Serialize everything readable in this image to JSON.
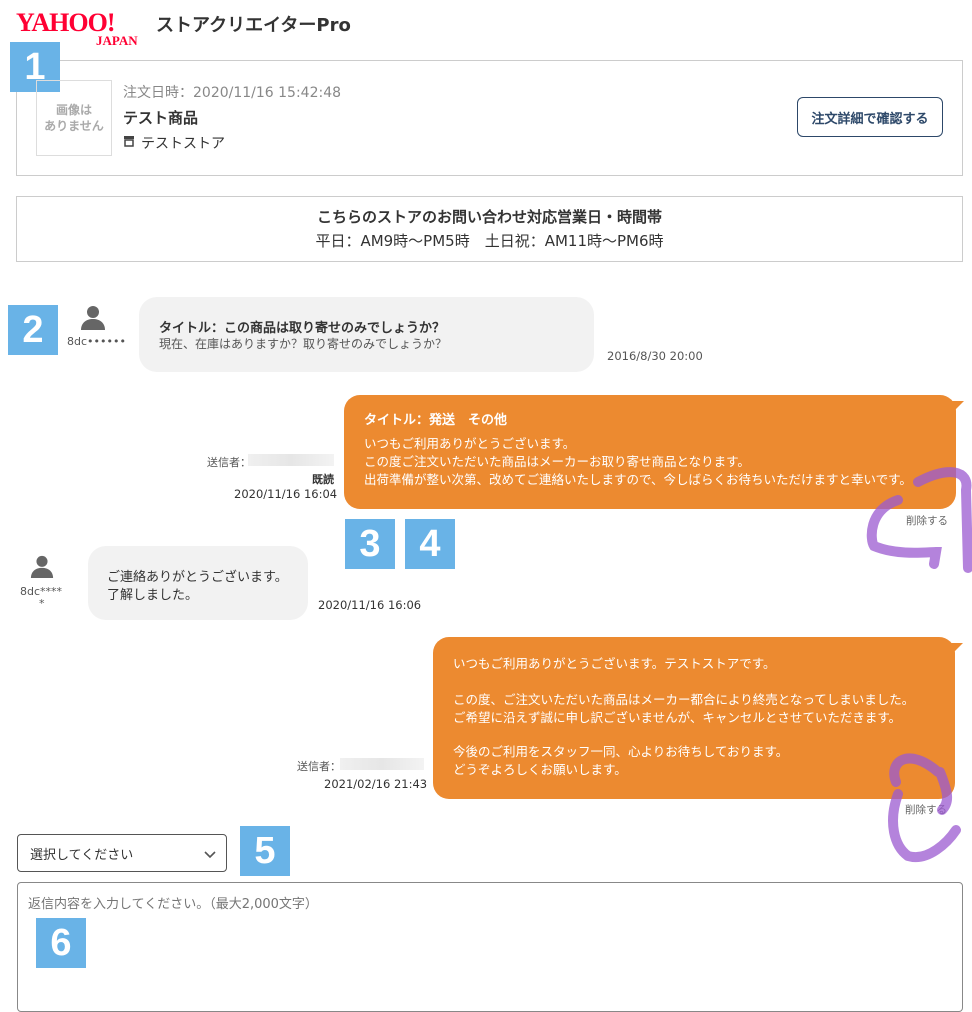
{
  "header": {
    "logo_main": "YAHOO!",
    "logo_sub": "JAPAN",
    "app_title": "ストアクリエイターPro"
  },
  "badges": [
    "1",
    "2",
    "3",
    "4",
    "5",
    "6"
  ],
  "order": {
    "date_label": "注文日時：2020/11/16 15:42:48",
    "product_name": "テスト商品",
    "store_name": "テストストア",
    "no_image_line1": "画像は",
    "no_image_line2": "ありません",
    "detail_button": "注文詳細で確認する"
  },
  "hours": {
    "title": "こちらのストアのお問い合わせ対応営業日・時間帯",
    "text": "平日：AM9時〜PM5時　土日祝：AM11時〜PM6時"
  },
  "messages": [
    {
      "sender": "8dc••••••",
      "title": "タイトル：この商品は取り寄せのみでしょうか？",
      "body": "現在、在庫はありますか？取り寄せのみでしょうか？",
      "time": "2016/8/30 20:00"
    },
    {
      "sender_label": "送信者：",
      "read": "既読",
      "time": "2020/11/16 16:04",
      "title": "タイトル：発送　その他",
      "lines": [
        "いつもご利用ありがとうございます。",
        "この度ご注文いただいた商品はメーカーお取り寄せ商品となります。",
        "出荷準備が整い次第、改めてご連絡いたしますので、今しばらくお待ちいただけますと幸いです。"
      ],
      "delete": "削除する"
    },
    {
      "sender": "8dc****",
      "sender2": "*",
      "lines": [
        "ご連絡ありがとうございます。",
        "了解しました。"
      ],
      "time": "2020/11/16 16:06"
    },
    {
      "sender_label": "送信者：",
      "time": "2021/02/16 21:43",
      "lines": [
        "いつもご利用ありがとうございます。テストストアです。",
        "",
        "この度、ご注文いただいた商品はメーカー都合により終売となってしまいました。",
        "ご希望に沿えず誠に申し訳ございませんが、キャンセルとさせていただきます。",
        "",
        "今後のご利用をスタッフ一同、心よりお待ちしております。",
        "どうぞよろしくお願いします。"
      ],
      "delete": "削除する"
    }
  ],
  "reply": {
    "select_value": "選択してください",
    "placeholder": "返信内容を入力してください。（最大2,000文字）"
  },
  "colors": {
    "accent_orange": "#ec8a30",
    "badge_blue": "#69b3e7",
    "logo_red": "#ff0033",
    "annotation_purple": "#9b59d0"
  },
  "icons": {
    "avatar": "person-icon",
    "store": "shop-icon",
    "chevron": "chevron-down-icon"
  }
}
